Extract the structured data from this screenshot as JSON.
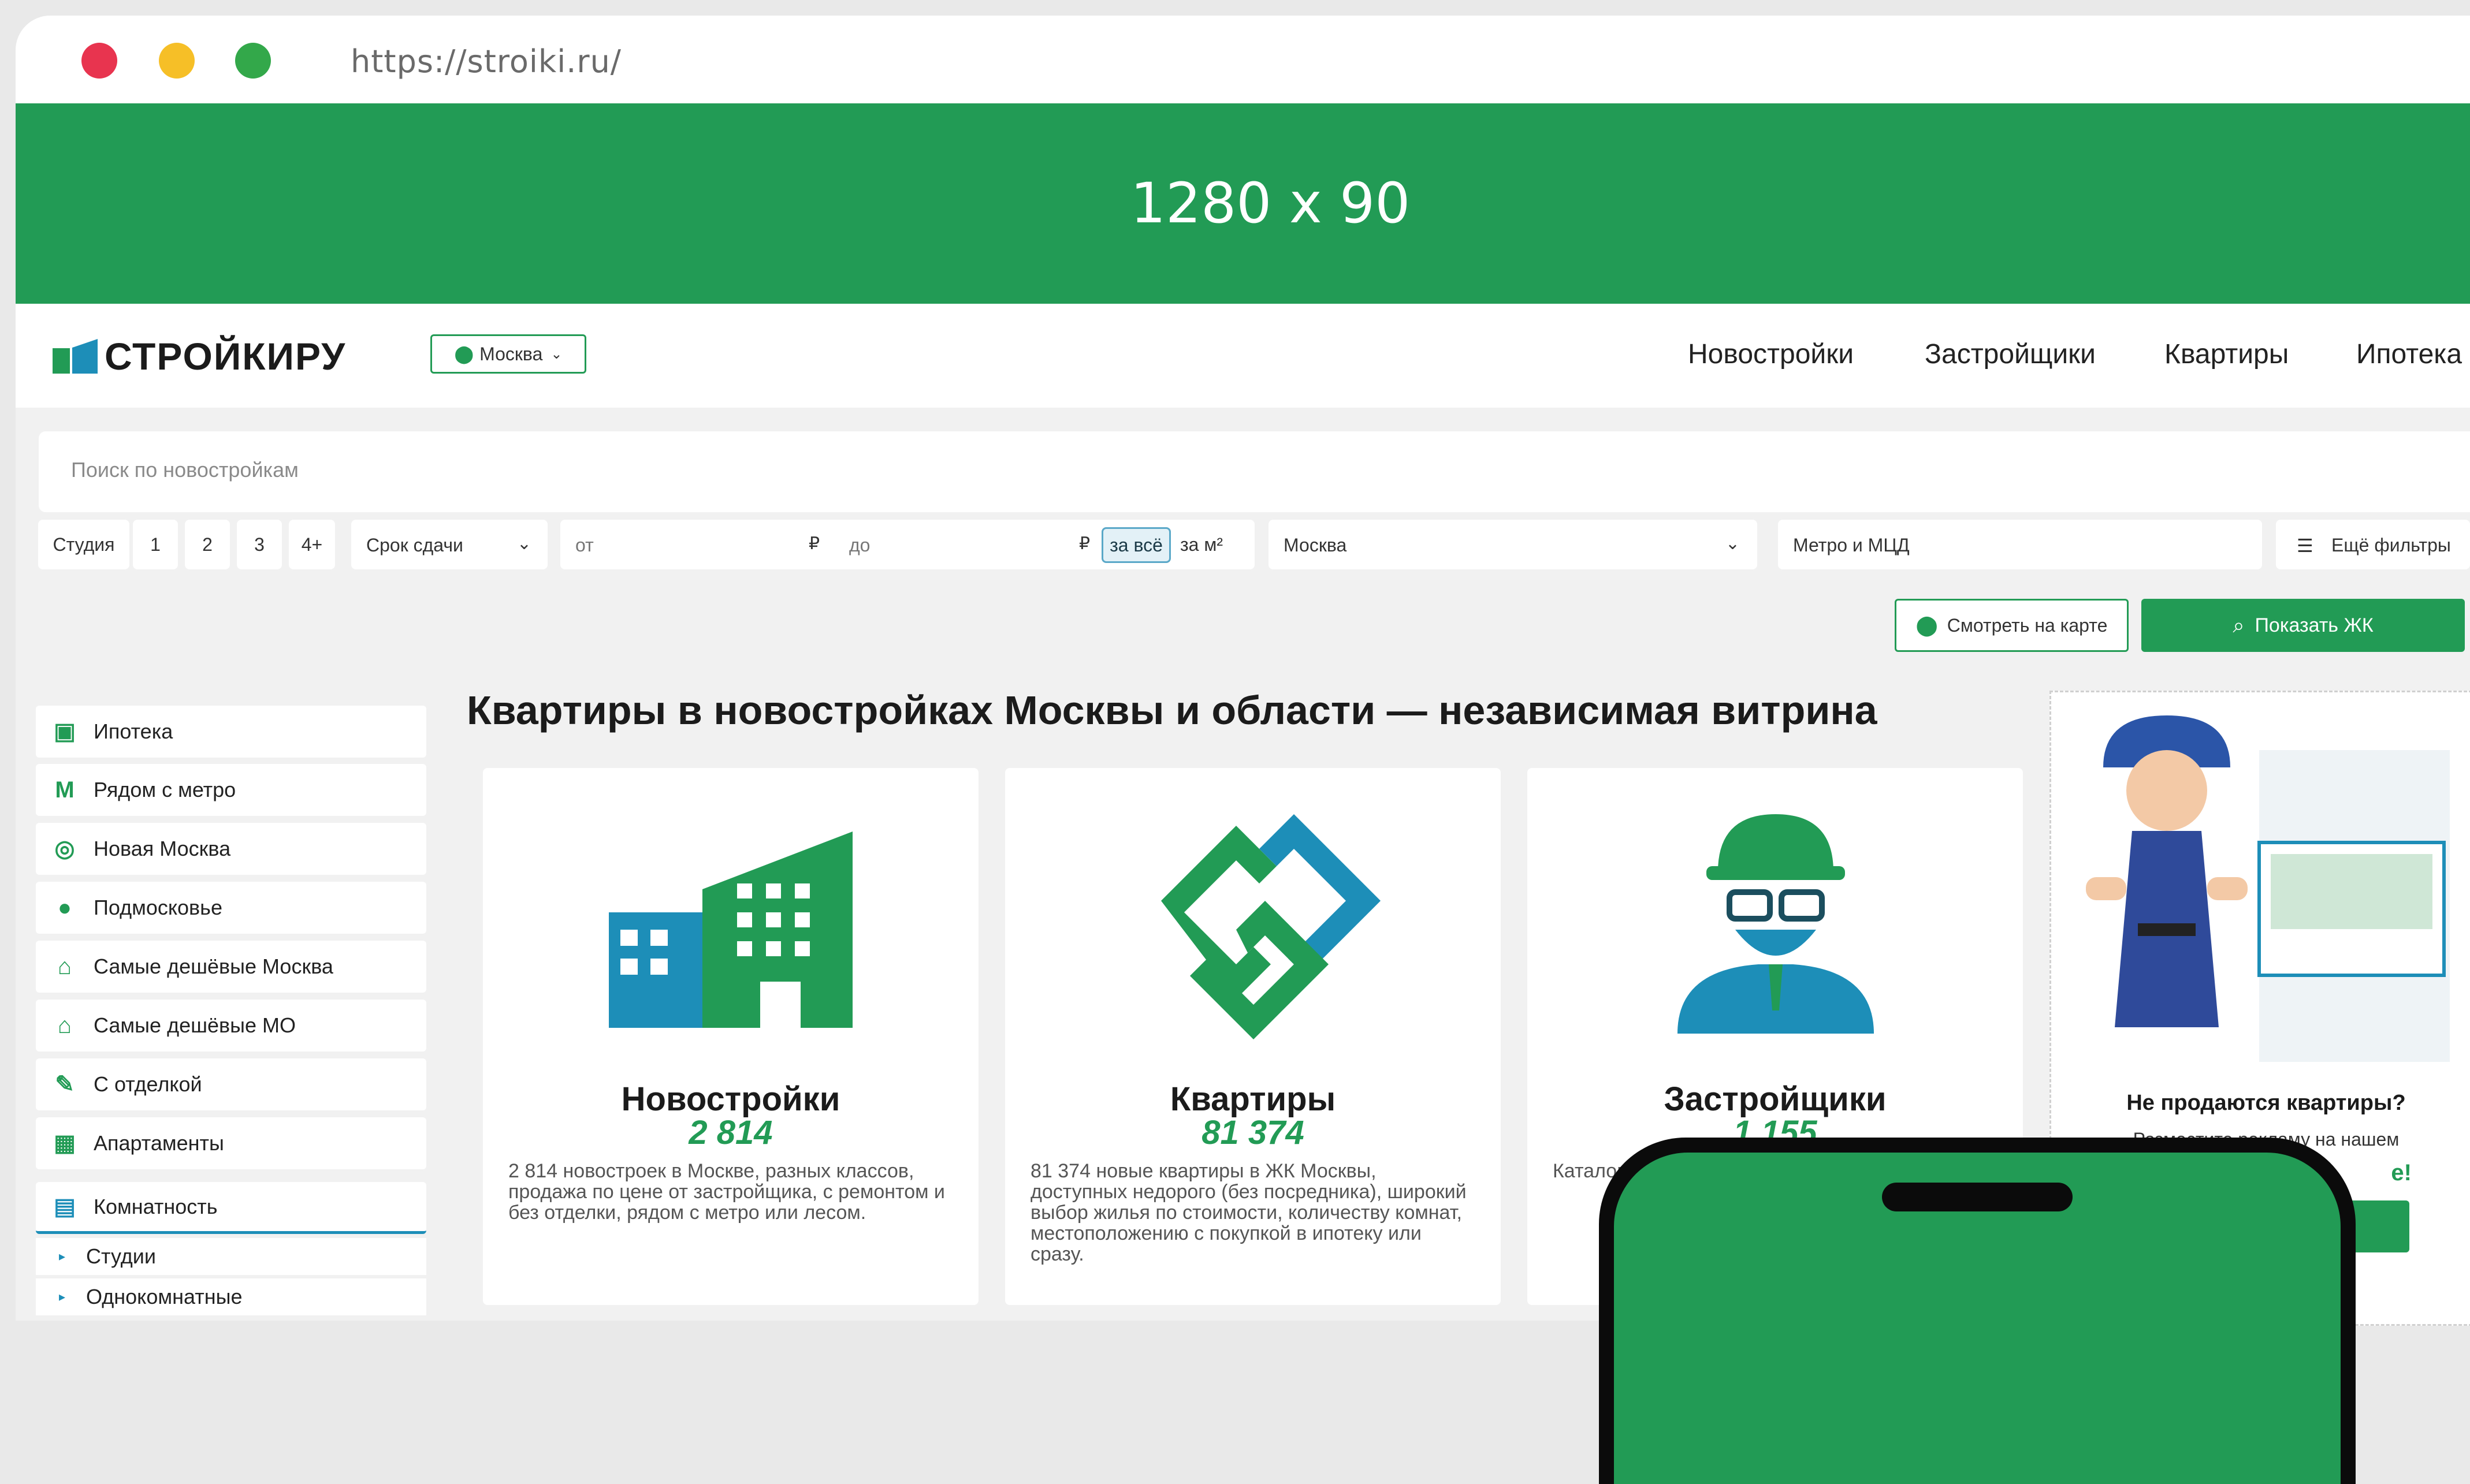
{
  "browser": {
    "url": "https://stroiki.ru/"
  },
  "banner": {
    "text": "1280 x 90"
  },
  "header": {
    "logo_text": "СТРОЙКИРУ",
    "city": "Москва",
    "nav": [
      "Новостройки",
      "Застройщики",
      "Квартиры",
      "Ипотека"
    ]
  },
  "search": {
    "placeholder": "Поиск по новостройкам"
  },
  "filters": {
    "rooms": [
      "Студия",
      "1",
      "2",
      "3",
      "4+"
    ],
    "deadline": "Срок сдачи",
    "price_from": "от",
    "price_to": "до",
    "currency": "₽",
    "price_mode_all": "за всё",
    "price_mode_sqm": "за м²",
    "region": "Москва",
    "metro": "Метро и МЦД",
    "more": "Ещё фильтры",
    "map_button": "Смотреть на карте",
    "show_button": "Показать ЖК"
  },
  "sidebar": {
    "items": [
      {
        "label": "Ипотека",
        "icon": "mortgage-icon"
      },
      {
        "label": "Рядом с метро",
        "icon": "metro-icon"
      },
      {
        "label": "Новая Москва",
        "icon": "new-moscow-icon"
      },
      {
        "label": "Подмосковье",
        "icon": "region-icon"
      },
      {
        "label": "Самые дешёвые Москва",
        "icon": "price-tag-icon"
      },
      {
        "label": "Самые дешёвые МО",
        "icon": "price-tag-icon"
      },
      {
        "label": "С отделкой",
        "icon": "tools-icon"
      },
      {
        "label": "Апартаменты",
        "icon": "apartment-icon"
      },
      {
        "label": "Комнатность",
        "icon": "layout-icon"
      }
    ],
    "sub_items": [
      "Студии",
      "Однокомнатные"
    ]
  },
  "main": {
    "title": "Квартиры в новостройках Москвы и области — независимая витрина",
    "cards": [
      {
        "title": "Новостройки",
        "count": "2 814",
        "icon": "building-icon",
        "description": "2 814 новостроек в Москве, разных классов, продажа по цене от застройщика, с ремонтом и без отделки, рядом с метро или лесом."
      },
      {
        "title": "Квартиры",
        "count": "81 374",
        "icon": "flats-icon",
        "description": "81 374 новые квартиры в ЖК Москвы, доступных недорого (без посредника), широкий выбор жилья по стоимости, количеству комнат, местоположению с покупкой в ипотеку или сразу."
      },
      {
        "title": "Застройщики",
        "count": "1 155",
        "icon": "builder-icon",
        "description": "Каталог Москв инфо недв"
      }
    ]
  },
  "ad": {
    "title": "Не продаются квартиры?",
    "subtitle": "Разместите рекламу на нашем",
    "link": "e!"
  },
  "colors": {
    "brand_green": "#229b55",
    "brand_blue": "#1d8eb8"
  }
}
